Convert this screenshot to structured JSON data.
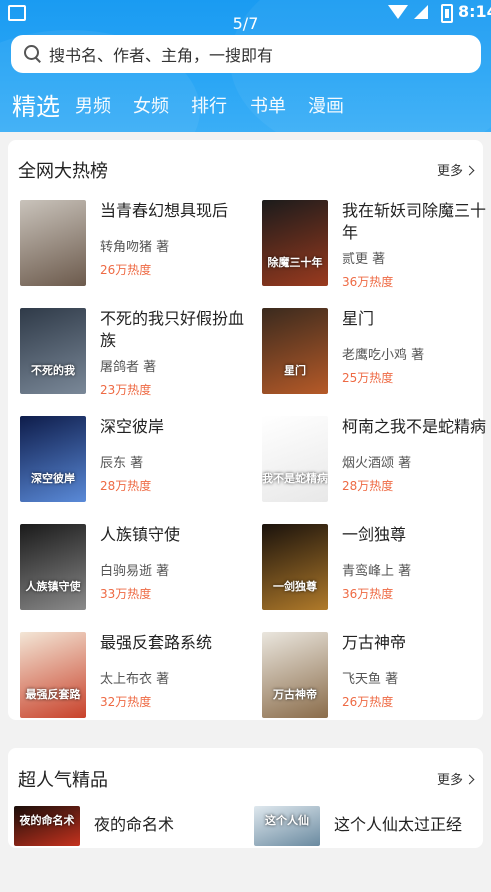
{
  "status_bar": {
    "counter": "5/7",
    "time": "8:14"
  },
  "search": {
    "placeholder": "搜书名、作者、主角，一搜即有"
  },
  "tabs": [
    {
      "label": "精选",
      "active": true
    },
    {
      "label": "男频",
      "active": false
    },
    {
      "label": "女频",
      "active": false
    },
    {
      "label": "排行",
      "active": false
    },
    {
      "label": "书单",
      "active": false
    },
    {
      "label": "漫画",
      "active": false
    }
  ],
  "section_hot": {
    "title": "全网大热榜",
    "more": "更多",
    "books": [
      {
        "title": "当青春幻想具现后",
        "author": "转角吻猪 著",
        "heat": "26万热度",
        "cover_colors": [
          "#c9c3bb",
          "#6c5a4c"
        ]
      },
      {
        "title": "我在斩妖司除魔三十年",
        "author": "贰更 著",
        "heat": "36万热度",
        "cover_colors": [
          "#1b1b1b",
          "#9a3a1e"
        ],
        "cover_text": "除魔三十年"
      },
      {
        "title": "不死的我只好假扮血族",
        "author": "屠鸽者 著",
        "heat": "23万热度",
        "cover_colors": [
          "#2f3a48",
          "#7a8898"
        ],
        "cover_text": "不死的我"
      },
      {
        "title": "星门",
        "author": "老鹰吃小鸡 著",
        "heat": "25万热度",
        "cover_colors": [
          "#3a2a1e",
          "#b65a28"
        ],
        "cover_text": "星门"
      },
      {
        "title": "深空彼岸",
        "author": "辰东 著",
        "heat": "28万热度",
        "cover_colors": [
          "#0e1c4a",
          "#5a8ad8"
        ],
        "cover_text": "深空彼岸"
      },
      {
        "title": "柯南之我不是蛇精病",
        "author": "烟火酒颂 著",
        "heat": "28万热度",
        "cover_colors": [
          "#ffffff",
          "#e8e8e8"
        ],
        "cover_text": "我不是蛇精病"
      },
      {
        "title": "人族镇守使",
        "author": "白驹易逝 著",
        "heat": "33万热度",
        "cover_colors": [
          "#1a1a1a",
          "#8a8a8a"
        ],
        "cover_text": "人族镇守使"
      },
      {
        "title": "一剑独尊",
        "author": "青鸾峰上 著",
        "heat": "36万热度",
        "cover_colors": [
          "#1a120c",
          "#b07a2a"
        ],
        "cover_text": "一剑独尊"
      },
      {
        "title": "最强反套路系统",
        "author": "太上布衣 著",
        "heat": "32万热度",
        "cover_colors": [
          "#f3e6d6",
          "#c8412a"
        ],
        "cover_text": "最强反套路"
      },
      {
        "title": "万古神帝",
        "author": "飞天鱼 著",
        "heat": "26万热度",
        "cover_colors": [
          "#eae6de",
          "#8a6c4a"
        ],
        "cover_text": "万古神帝"
      }
    ]
  },
  "section_popular": {
    "title": "超人气精品",
    "more": "更多",
    "books": [
      {
        "title": "夜的命名术",
        "cover_colors": [
          "#1a0e0a",
          "#c6321e"
        ],
        "cover_text": "夜的命名术"
      },
      {
        "title": "这个人仙太过正经",
        "cover_colors": [
          "#dfe8ee",
          "#6a8aa0"
        ],
        "cover_text": "这个人仙"
      }
    ]
  }
}
